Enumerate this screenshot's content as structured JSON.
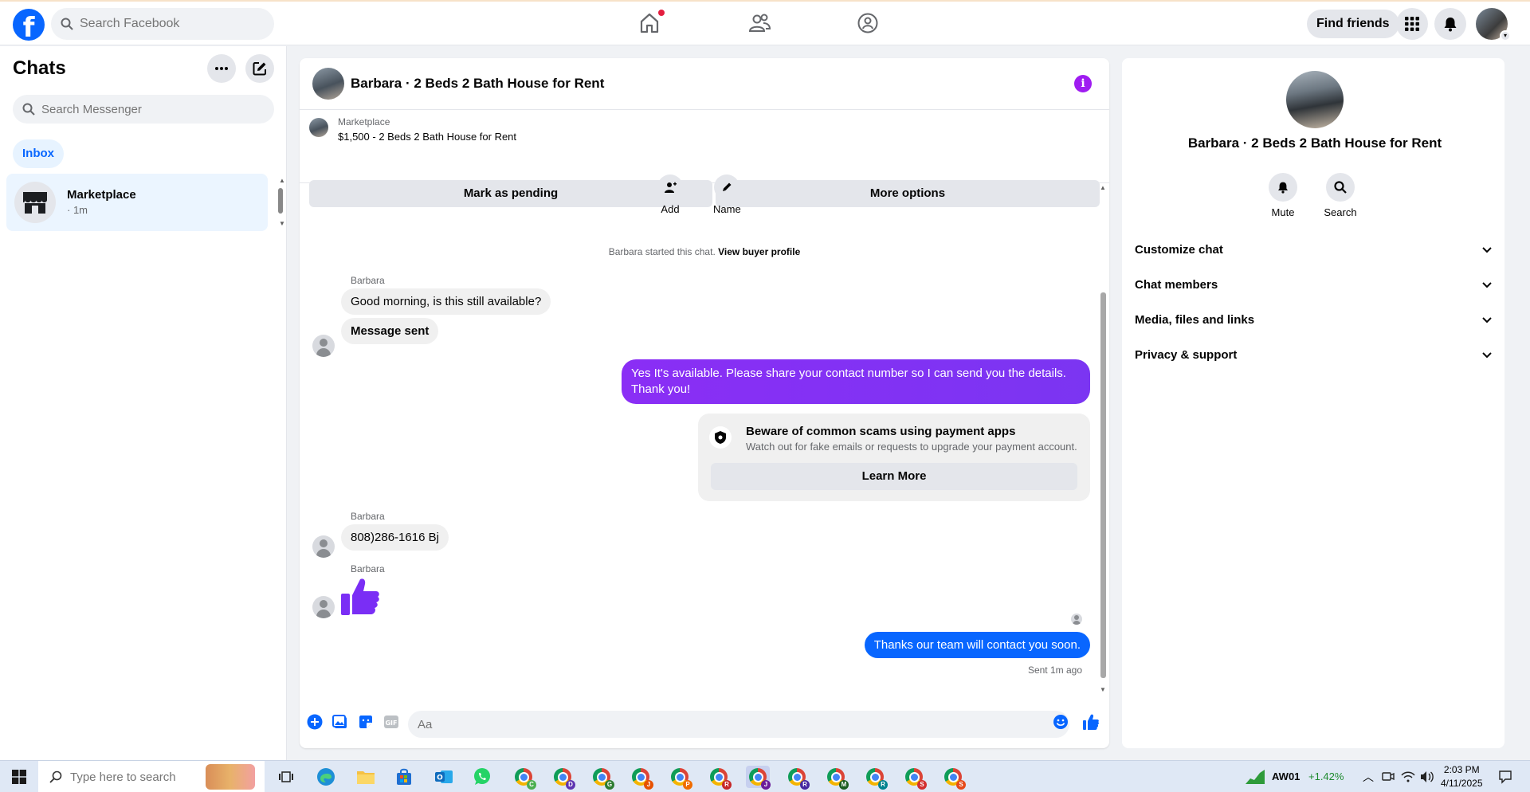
{
  "topbar": {
    "search_placeholder": "Search Facebook",
    "find_friends": "Find friends"
  },
  "sidebar": {
    "title": "Chats",
    "search_placeholder": "Search Messenger",
    "inbox_label": "Inbox",
    "threads": [
      {
        "name": "Marketplace",
        "time": "· 1m"
      }
    ]
  },
  "conversation": {
    "title": "Barbara · 2 Beds 2 Bath House for Rent",
    "marketplace_label": "Marketplace",
    "listing": "$1,500 - 2 Beds 2 Bath House for Rent",
    "mark_pending": "Mark as pending",
    "more_options": "More options",
    "controls": {
      "add": "Add",
      "name": "Name"
    },
    "started_text": "Barbara started this chat.",
    "view_buyer_profile": "View buyer profile",
    "messages": [
      {
        "sender": "Barbara",
        "text": "Good morning, is this still available?"
      },
      {
        "text": "Message sent"
      },
      {
        "text": "Yes It's available. Please share your contact number so I can send you the details. Thank you!"
      },
      {
        "sender": "Barbara",
        "text": "808)286-1616 Bj"
      },
      {
        "sender": "Barbara"
      },
      {
        "text": "Thanks our team will contact you soon."
      }
    ],
    "scam_notice": {
      "title": "Beware of common scams using payment apps",
      "subtitle": "Watch out for fake emails or requests to upgrade your payment account.",
      "button": "Learn More"
    },
    "sent_status": "Sent 1m ago",
    "composer_placeholder": "Aa",
    "accent_purple": "#8a2ef5",
    "accent_blue": "#0866ff"
  },
  "details_panel": {
    "name": "Barbara · 2 Beds 2 Bath House for Rent",
    "actions": {
      "mute": "Mute",
      "search": "Search"
    },
    "sections": [
      "Customize chat",
      "Chat members",
      "Media, files and links",
      "Privacy & support"
    ]
  },
  "taskbar": {
    "search_placeholder": "Type here to search",
    "stock_symbol": "AW01",
    "stock_change": "+1.42%",
    "time": "2:03 PM",
    "date": "4/11/2025",
    "apps": [
      {
        "icon": "chrome-icon",
        "letter": "C",
        "color": "#4caf50"
      },
      {
        "icon": "chrome-icon",
        "letter": "D",
        "color": "#5e35b1"
      },
      {
        "icon": "chrome-icon",
        "letter": "G",
        "color": "#2e7d32"
      },
      {
        "icon": "chrome-icon",
        "letter": "J",
        "color": "#e65100"
      },
      {
        "icon": "chrome-icon",
        "letter": "P",
        "color": "#ef6c00"
      },
      {
        "icon": "chrome-icon",
        "letter": "R",
        "color": "#c62828"
      },
      {
        "icon": "chrome-icon",
        "letter": "J",
        "color": "#6a1b9a"
      },
      {
        "icon": "chrome-icon",
        "letter": "R",
        "color": "#4527a0"
      },
      {
        "icon": "chrome-icon",
        "letter": "M",
        "color": "#1b5e20"
      },
      {
        "icon": "chrome-icon",
        "letter": "R",
        "color": "#00838f"
      },
      {
        "icon": "chrome-icon",
        "letter": "S",
        "color": "#d32f2f"
      },
      {
        "icon": "chrome-icon",
        "letter": "S",
        "color": "#e64a19"
      }
    ]
  }
}
